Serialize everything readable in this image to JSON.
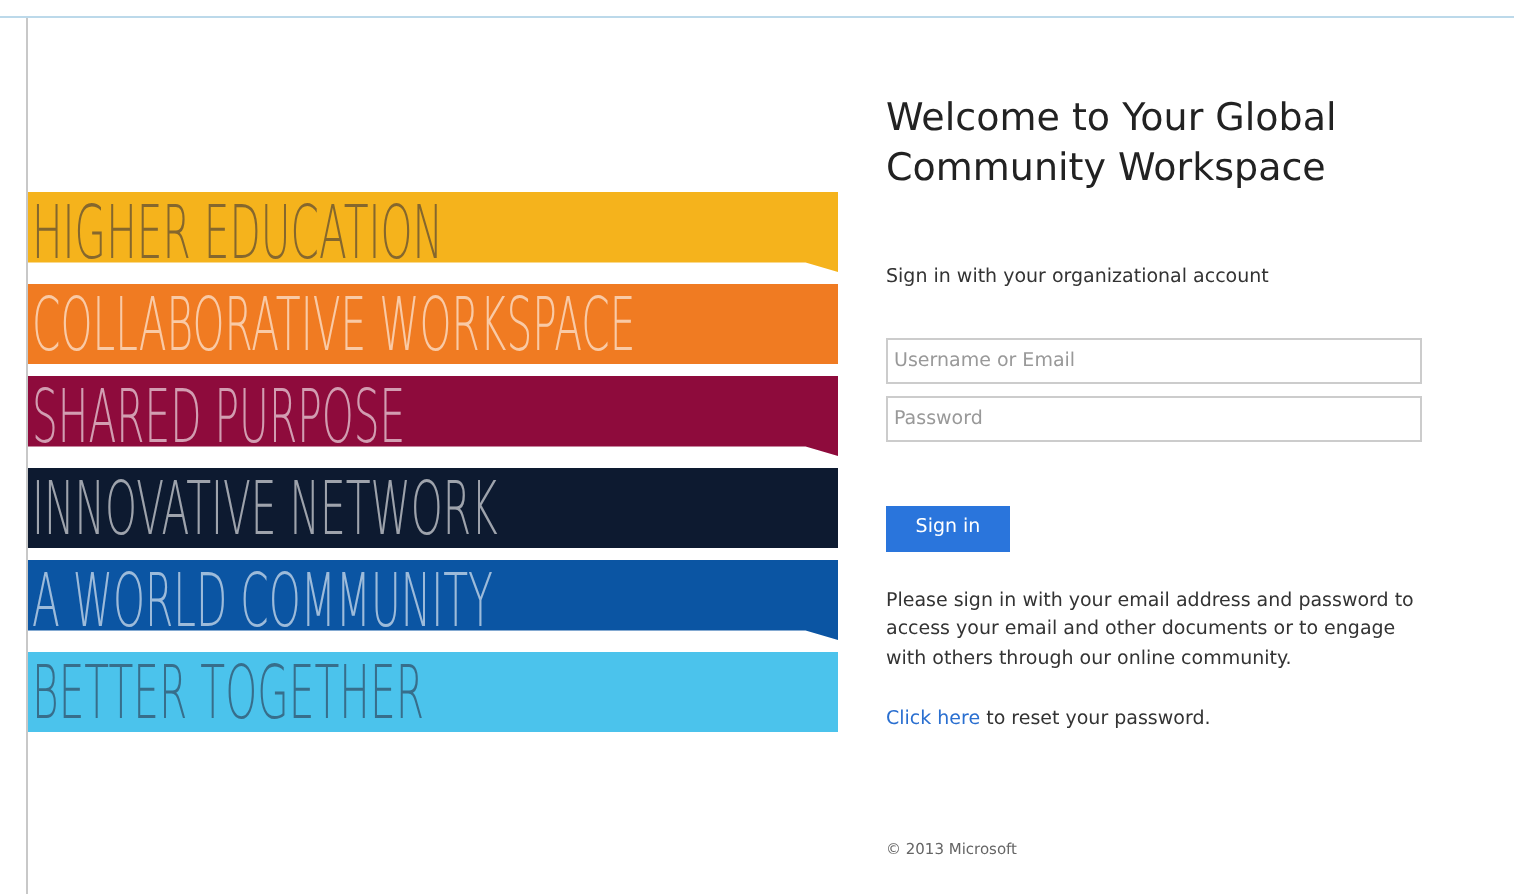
{
  "banners": [
    {
      "text": "HIGHER EDUCATION",
      "color": "#f5b31c"
    },
    {
      "text": "COLLABORATIVE WORKSPACE",
      "color": "#f07b22"
    },
    {
      "text": "SHARED PURPOSE",
      "color": "#8e0b3c"
    },
    {
      "text": "INNOVATIVE NETWORK",
      "color": "#0d1a30"
    },
    {
      "text": "A WORLD COMMUNITY",
      "color": "#0b55a3"
    },
    {
      "text": "BETTER TOGETHER",
      "color": "#4bc3ec"
    }
  ],
  "title": "Welcome to Your Global Community Workspace",
  "subtitle": "Sign in with your organizational account",
  "fields": [
    {
      "placeholder": "Username or Email"
    },
    {
      "placeholder": "Password"
    }
  ],
  "button": "Sign in",
  "description": "Please sign in with your email address and password to access your email and other documents or to engage with others through our online community.",
  "reset": {
    "link": "Click here",
    "text": " to reset your password."
  },
  "footer": "© 2013 Microsoft"
}
